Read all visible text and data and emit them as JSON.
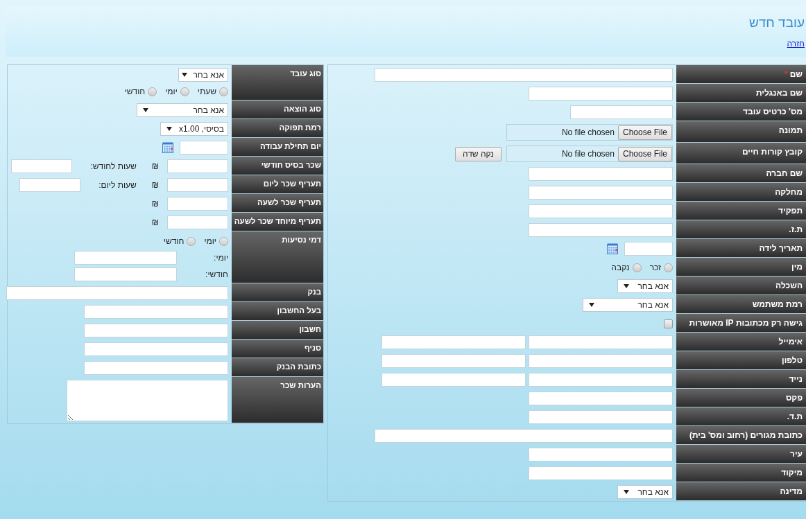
{
  "title": "עובד חדש",
  "back_link": "חזרה",
  "main_form": {
    "rows": [
      {
        "label": "שם",
        "mark": "*",
        "lines": [
          [
            {
              "kind": "longtext"
            }
          ]
        ]
      },
      {
        "label": "שם באנגלית",
        "lines": [
          [
            {
              "kind": "text"
            }
          ]
        ]
      },
      {
        "label": "מס' כרטיס עובד",
        "lines": [
          [
            {
              "kind": "shorttext"
            }
          ]
        ]
      },
      {
        "label": "תמונה",
        "lines": [
          [
            {
              "kind": "file",
              "button": "Choose File",
              "status": "No file chosen"
            }
          ]
        ]
      },
      {
        "label": "קובץ קורות חיים",
        "lines": [
          [
            {
              "kind": "file",
              "button": "Choose File",
              "status": "No file chosen"
            },
            {
              "kind": "button",
              "label": "נקה שדה"
            }
          ]
        ]
      },
      {
        "label": "שם חברה",
        "lines": [
          [
            {
              "kind": "text"
            }
          ]
        ]
      },
      {
        "label": "מחלקה",
        "lines": [
          [
            {
              "kind": "text"
            }
          ]
        ]
      },
      {
        "label": "תפקיד",
        "lines": [
          [
            {
              "kind": "text"
            }
          ]
        ]
      },
      {
        "label": "ת.ז.",
        "lines": [
          [
            {
              "kind": "text"
            }
          ]
        ]
      },
      {
        "label": "תאריך לידה",
        "lines": [
          [
            {
              "kind": "date"
            }
          ]
        ]
      },
      {
        "label": "מין",
        "lines": [
          [
            {
              "kind": "radio",
              "label": "זכר",
              "selected": false
            },
            {
              "kind": "radio",
              "label": "נקבה",
              "selected": false
            }
          ]
        ]
      },
      {
        "label": "השכלה",
        "lines": [
          [
            {
              "kind": "select",
              "value": "אנא בחר"
            }
          ]
        ]
      },
      {
        "label": "רמת משתמש",
        "lines": [
          [
            {
              "kind": "wideselect",
              "value": "אנא בחר"
            }
          ]
        ]
      },
      {
        "label": "גישה רק מכתובות IP מאושרות",
        "lines": [
          [
            {
              "kind": "checkbox",
              "checked": false
            }
          ]
        ]
      },
      {
        "label": "אימייל",
        "lines": [
          [
            {
              "kind": "text"
            },
            {
              "kind": "text"
            }
          ]
        ]
      },
      {
        "label": "טלפון",
        "lines": [
          [
            {
              "kind": "text"
            },
            {
              "kind": "text"
            }
          ]
        ]
      },
      {
        "label": "נייד",
        "lines": [
          [
            {
              "kind": "text"
            },
            {
              "kind": "text"
            }
          ]
        ]
      },
      {
        "label": "פקס",
        "lines": [
          [
            {
              "kind": "text"
            }
          ]
        ]
      },
      {
        "label": "ת.ד.",
        "lines": [
          [
            {
              "kind": "text"
            }
          ]
        ]
      },
      {
        "label": "כתובת מגורים (רחוב ומס' בית)",
        "lines": [
          [
            {
              "kind": "longtext"
            }
          ]
        ]
      },
      {
        "label": "עיר",
        "lines": [
          [
            {
              "kind": "text"
            }
          ]
        ]
      },
      {
        "label": "מיקוד",
        "lines": [
          [
            {
              "kind": "text"
            }
          ]
        ]
      },
      {
        "label": "מדינה",
        "lines": [
          [
            {
              "kind": "select",
              "value": "אנא בחר"
            }
          ]
        ]
      }
    ]
  },
  "pay_form": {
    "rows": [
      {
        "label": "סוג עובד",
        "lines": [
          [
            {
              "kind": "select",
              "value": "אנא בחר"
            }
          ],
          [
            {
              "kind": "radio",
              "label": "שעתי",
              "selected": false
            },
            {
              "kind": "radio",
              "label": "יומי",
              "selected": false
            },
            {
              "kind": "radio",
              "label": "חודשי",
              "selected": false
            }
          ]
        ]
      },
      {
        "label": "סוג הוצאה",
        "lines": [
          [
            {
              "kind": "wideselect",
              "value": "אנא בחר"
            }
          ]
        ]
      },
      {
        "label": "רמת תפוקה",
        "lines": [
          [
            {
              "kind": "select",
              "value": "בסיסי, x1.00"
            }
          ]
        ]
      },
      {
        "label": "יום תחילת עבודה",
        "lines": [
          [
            {
              "kind": "date"
            }
          ]
        ]
      },
      {
        "label": "שכר בסיס חודשי",
        "lines": [
          [
            {
              "kind": "numtext"
            },
            {
              "kind": "currency",
              "text": "₪"
            },
            {
              "kind": "caption",
              "text": "שעות לחודש:"
            },
            {
              "kind": "numtext"
            }
          ]
        ]
      },
      {
        "label": "תעריף שכר ליום",
        "lines": [
          [
            {
              "kind": "numtext"
            },
            {
              "kind": "currency",
              "text": "₪"
            },
            {
              "kind": "caption",
              "text": "שעות ליום:"
            },
            {
              "kind": "numtext"
            }
          ]
        ]
      },
      {
        "label": "תעריף שכר לשעה",
        "lines": [
          [
            {
              "kind": "numtext"
            },
            {
              "kind": "currency",
              "text": "₪"
            }
          ]
        ]
      },
      {
        "label": "תעריף מיוחד שכר לשעה",
        "lines": [
          [
            {
              "kind": "numtext"
            },
            {
              "kind": "currency",
              "text": "₪"
            }
          ]
        ]
      },
      {
        "label": "דמי נסיעות",
        "lines": [
          [
            {
              "kind": "radio",
              "label": "יומי",
              "selected": false
            },
            {
              "kind": "radio",
              "label": "חודשי",
              "selected": false
            }
          ],
          [
            {
              "kind": "caption",
              "text": "יומי:"
            },
            {
              "kind": "shorttext"
            }
          ],
          [
            {
              "kind": "caption",
              "text": "חודשי:"
            },
            {
              "kind": "shorttext"
            }
          ]
        ]
      },
      {
        "label": "בנק",
        "lines": [
          [
            {
              "kind": "longtext"
            }
          ]
        ]
      },
      {
        "label": "בעל החשבון",
        "lines": [
          [
            {
              "kind": "text"
            }
          ]
        ]
      },
      {
        "label": "חשבון",
        "lines": [
          [
            {
              "kind": "text"
            }
          ]
        ]
      },
      {
        "label": "סניף",
        "lines": [
          [
            {
              "kind": "text"
            }
          ]
        ]
      },
      {
        "label": "כתובת הבנק",
        "lines": [
          [
            {
              "kind": "text"
            }
          ]
        ]
      },
      {
        "label": "הערות שכר",
        "lines": [
          [
            {
              "kind": "textarea"
            }
          ]
        ]
      }
    ]
  }
}
